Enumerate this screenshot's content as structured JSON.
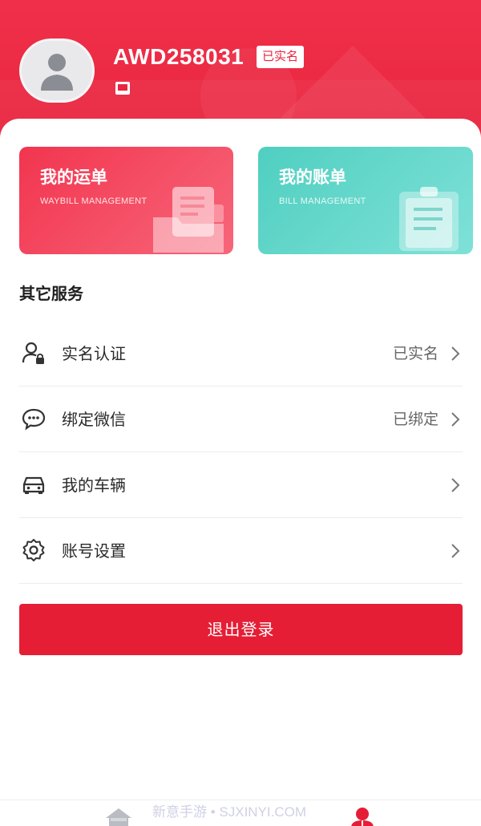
{
  "profile": {
    "username": "AWD258031",
    "verified_badge": "已实名"
  },
  "cards": [
    {
      "title": "我的运单",
      "subtitle": "WAYBILL MANAGEMENT"
    },
    {
      "title": "我的账单",
      "subtitle": "BILL MANAGEMENT"
    }
  ],
  "section": {
    "title": "其它服务"
  },
  "menu": [
    {
      "label": "实名认证",
      "status": "已实名",
      "icon": "user-lock-icon"
    },
    {
      "label": "绑定微信",
      "status": "已绑定",
      "icon": "chat-bubble-icon"
    },
    {
      "label": "我的车辆",
      "status": "",
      "icon": "car-icon"
    },
    {
      "label": "账号设置",
      "status": "",
      "icon": "gear-icon"
    }
  ],
  "logout": {
    "label": "退出登录"
  },
  "watermark": "新意手游 • SJXINYI.COM",
  "colors": {
    "primary": "#e9253f",
    "teal": "#4fcfc0",
    "text": "#222222"
  }
}
